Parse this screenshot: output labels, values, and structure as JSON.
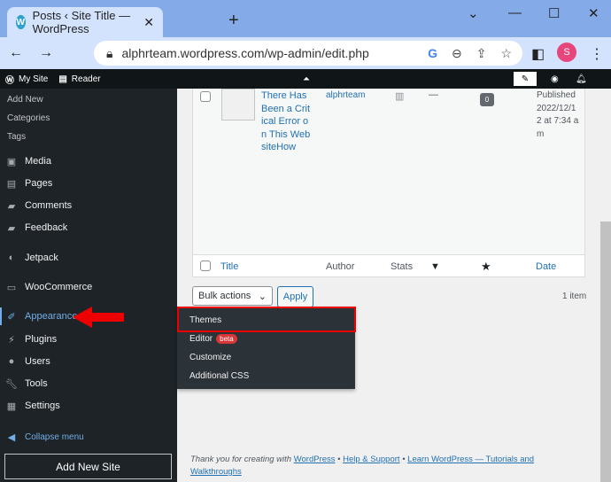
{
  "browser": {
    "tab_title": "Posts ‹ Site Title — WordPress",
    "url": "alphrteam.wordpress.com/wp-admin/edit.php",
    "profile_initial": "S"
  },
  "adminbar": {
    "my_site": "My Site",
    "reader": "Reader"
  },
  "sidebar": {
    "sub_items": [
      "Add New",
      "Categories",
      "Tags"
    ],
    "items": [
      {
        "label": "Media",
        "icon": "media-icon"
      },
      {
        "label": "Pages",
        "icon": "pages-icon"
      },
      {
        "label": "Comments",
        "icon": "comments-icon"
      },
      {
        "label": "Feedback",
        "icon": "feedback-icon"
      },
      {
        "label": "Jetpack",
        "icon": "jetpack-icon"
      },
      {
        "label": "WooCommerce",
        "icon": "woocommerce-icon"
      },
      {
        "label": "Appearance",
        "icon": "brush-icon"
      },
      {
        "label": "Plugins",
        "icon": "plugin-icon"
      },
      {
        "label": "Users",
        "icon": "users-icon"
      },
      {
        "label": "Tools",
        "icon": "wrench-icon"
      },
      {
        "label": "Settings",
        "icon": "settings-icon"
      }
    ],
    "collapse": "Collapse menu",
    "add_new_site": "Add New Site"
  },
  "post": {
    "title": "There Has Been a Critical Error on This WebsiteHow",
    "author": "alphrteam",
    "tags": "—",
    "comments": "0",
    "date": "Published 2022/12/12 at 7:34 am"
  },
  "columns": {
    "title": "Title",
    "author": "Author",
    "stats": "Stats",
    "date": "Date"
  },
  "bulk_actions": "Bulk actions",
  "apply": "Apply",
  "count": "1 item",
  "flyout": {
    "themes": "Themes",
    "editor": "Editor",
    "beta": "beta",
    "customize": "Customize",
    "additional_css": "Additional CSS"
  },
  "footer": {
    "text": "Thank you for creating with",
    "wordpress": "WordPress",
    "sep": "•",
    "help": "Help & Support",
    "learn": "Learn WordPress — Tutorials and Walkthroughs"
  },
  "colors": {
    "accent": "#2271b1",
    "highlight": "#e00000"
  }
}
